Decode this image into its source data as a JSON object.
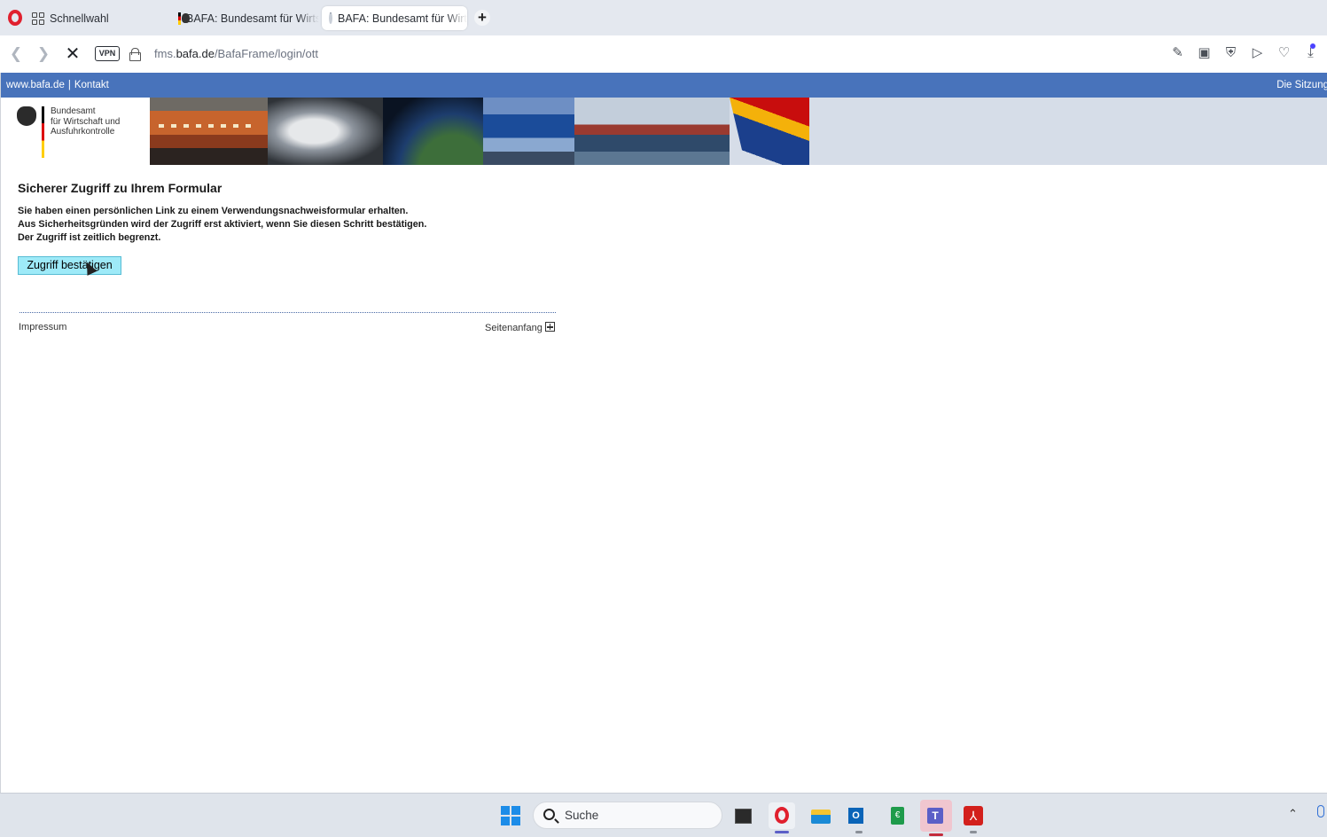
{
  "browser": {
    "speed_dial_label": "Schnellwahl",
    "tabs": [
      {
        "title": "BAFA: Bundesamt für Wirtschaft",
        "active": false
      },
      {
        "title": "BAFA: Bundesamt für Wirtschaft",
        "active": true
      }
    ],
    "vpn_label": "VPN",
    "url": {
      "prefix": "fms.",
      "domain": "bafa.de",
      "path": "/BafaFrame/login/ott"
    },
    "icons": [
      "back-icon",
      "forward-icon",
      "stop-icon",
      "lock-icon",
      "edit-icon",
      "camera-icon",
      "shield-icon",
      "play-icon",
      "heart-icon",
      "download-icon"
    ]
  },
  "site": {
    "topnav": {
      "home_link": "www.bafa.de",
      "separator": "|",
      "contact_link": "Kontakt",
      "session_text": "Die Sitzung"
    },
    "logo_text": "Bundesamt\nfür Wirtschaft und\nAusfuhrkontrolle",
    "heading": "Sicherer Zugriff zu Ihrem Formular",
    "paragraphs": [
      "Sie haben einen persönlichen Link zu einem Verwendungsnachweisformular erhalten.",
      "Aus Sicherheitsgründen wird der Zugriff erst aktiviert, wenn Sie diesen Schritt bestätigen.",
      "Der Zugriff ist zeitlich begrenzt."
    ],
    "confirm_button": "Zugriff bestätigen",
    "footer": {
      "impressum": "Impressum",
      "top_link": "Seitenanfang"
    }
  },
  "taskbar": {
    "search_label": "Suche",
    "apps": [
      "task-view",
      "opera",
      "file-explorer",
      "outlook",
      "finance-app",
      "teams",
      "acrobat"
    ]
  },
  "colors": {
    "bafa_blue": "#4873bb",
    "button_bg": "#9eeaf8",
    "opera_red": "#e0202e"
  }
}
